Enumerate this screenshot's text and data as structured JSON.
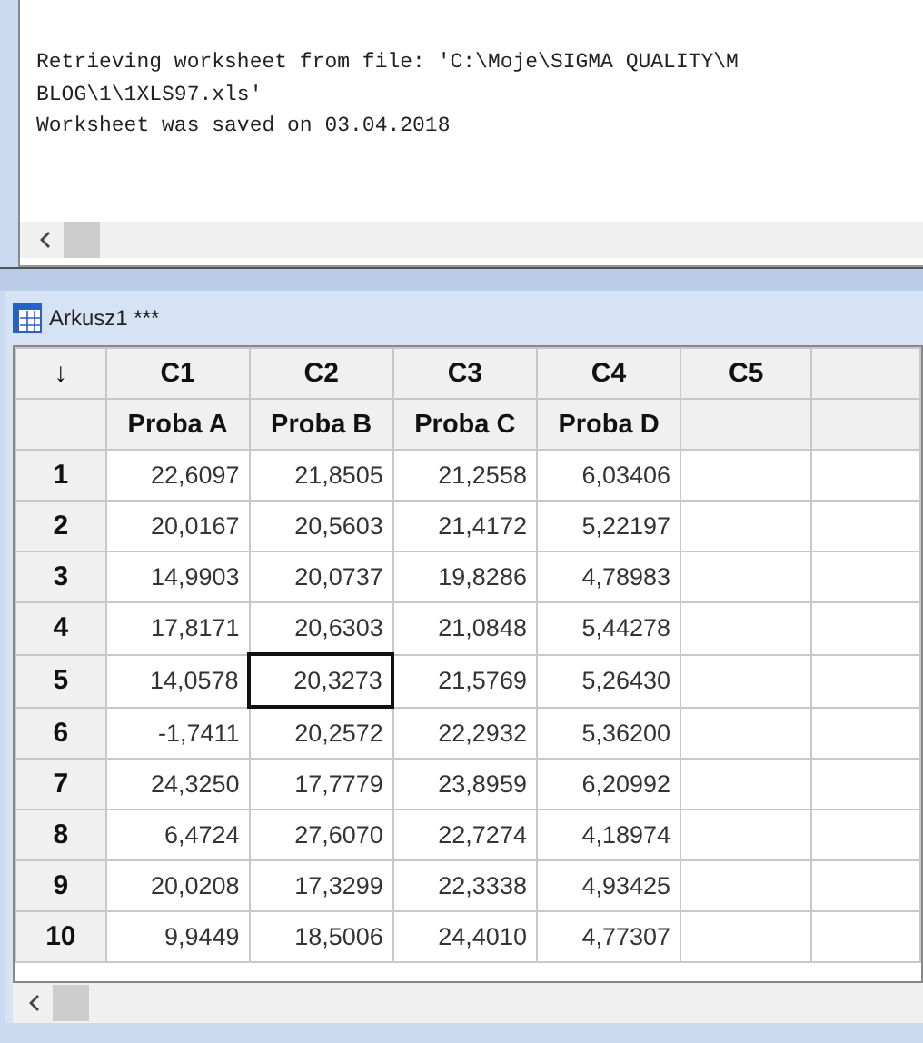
{
  "session": {
    "lines": [
      "Retrieving worksheet from file: 'C:\\Moje\\SIGMA QUALITY\\M",
      "BLOG\\1\\1XLS97.xls'",
      "Worksheet was saved on 03.04.2018"
    ]
  },
  "worksheet": {
    "title": "Arkusz1 ***",
    "corner": "↓",
    "columns": [
      {
        "id": "C1",
        "name": "Proba A"
      },
      {
        "id": "C2",
        "name": "Proba B"
      },
      {
        "id": "C3",
        "name": "Proba C"
      },
      {
        "id": "C4",
        "name": "Proba D"
      },
      {
        "id": "C5"
      }
    ],
    "rows": [
      {
        "label": "1",
        "cells": [
          {
            "value": "22,6097",
            "selected": false
          },
          {
            "value": "21,8505",
            "selected": false
          },
          {
            "value": "21,2558",
            "selected": false
          },
          {
            "value": "6,03406",
            "selected": false
          }
        ]
      },
      {
        "label": "2",
        "cells": [
          {
            "value": "20,0167",
            "selected": false
          },
          {
            "value": "20,5603",
            "selected": false
          },
          {
            "value": "21,4172",
            "selected": false
          },
          {
            "value": "5,22197",
            "selected": false
          }
        ]
      },
      {
        "label": "3",
        "cells": [
          {
            "value": "14,9903",
            "selected": false
          },
          {
            "value": "20,0737",
            "selected": false
          },
          {
            "value": "19,8286",
            "selected": false
          },
          {
            "value": "4,78983",
            "selected": false
          }
        ]
      },
      {
        "label": "4",
        "cells": [
          {
            "value": "17,8171",
            "selected": false
          },
          {
            "value": "20,6303",
            "selected": false
          },
          {
            "value": "21,0848",
            "selected": false
          },
          {
            "value": "5,44278",
            "selected": false
          }
        ]
      },
      {
        "label": "5",
        "cells": [
          {
            "value": "14,0578",
            "selected": false
          },
          {
            "value": "20,3273",
            "selected": true
          },
          {
            "value": "21,5769",
            "selected": false
          },
          {
            "value": "5,26430",
            "selected": false
          }
        ]
      },
      {
        "label": "6",
        "cells": [
          {
            "value": "-1,7411",
            "selected": false
          },
          {
            "value": "20,2572",
            "selected": false
          },
          {
            "value": "22,2932",
            "selected": false
          },
          {
            "value": "5,36200",
            "selected": false
          }
        ]
      },
      {
        "label": "7",
        "cells": [
          {
            "value": "24,3250",
            "selected": false
          },
          {
            "value": "17,7779",
            "selected": false
          },
          {
            "value": "23,8959",
            "selected": false
          },
          {
            "value": "6,20992",
            "selected": false
          }
        ]
      },
      {
        "label": "8",
        "cells": [
          {
            "value": "6,4724",
            "selected": false
          },
          {
            "value": "27,6070",
            "selected": false
          },
          {
            "value": "22,7274",
            "selected": false
          },
          {
            "value": "4,18974",
            "selected": false
          }
        ]
      },
      {
        "label": "9",
        "cells": [
          {
            "value": "20,0208",
            "selected": false
          },
          {
            "value": "17,3299",
            "selected": false
          },
          {
            "value": "22,3338",
            "selected": false
          },
          {
            "value": "4,93425",
            "selected": false
          }
        ]
      },
      {
        "label": "10",
        "cells": [
          {
            "value": "9,9449",
            "selected": false
          },
          {
            "value": "18,5006",
            "selected": false
          },
          {
            "value": "24,4010",
            "selected": false
          },
          {
            "value": "4,77307",
            "selected": false
          }
        ]
      }
    ]
  }
}
